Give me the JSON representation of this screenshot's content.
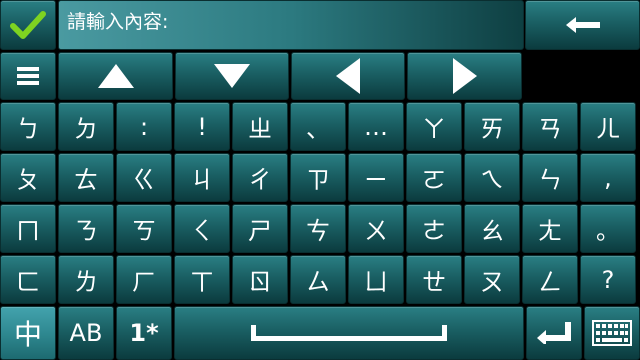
{
  "input": {
    "placeholder": "請輸入內容:"
  },
  "icons": {
    "confirm": "checkmark-icon",
    "backspace": "arrow-left-icon",
    "menu": "menu-icon",
    "up": "arrow-up-icon",
    "down": "arrow-down-icon",
    "left": "arrow-left-icon",
    "right": "arrow-right-icon",
    "space": "space-bar-icon",
    "enter": "enter-icon",
    "keyboard": "keyboard-icon"
  },
  "rows": [
    [
      "ㄅ",
      "ㄉ",
      ":",
      "!",
      "ㄓ",
      "、",
      "…",
      "ㄚ",
      "ㄞ",
      "ㄢ",
      "ㄦ"
    ],
    [
      "ㄆ",
      "ㄊ",
      "ㄍ",
      "ㄐ",
      "ㄔ",
      "ㄗ",
      "ㄧ",
      "ㄛ",
      "ㄟ",
      "ㄣ",
      ","
    ],
    [
      "ㄇ",
      "ㄋ",
      "ㄎ",
      "ㄑ",
      "ㄕ",
      "ㄘ",
      "ㄨ",
      "ㄜ",
      "ㄠ",
      "ㄤ",
      "。"
    ],
    [
      "ㄈ",
      "ㄌ",
      "ㄏ",
      "ㄒ",
      "ㄖ",
      "ㄙ",
      "ㄩ",
      "ㄝ",
      "ㄡ",
      "ㄥ",
      "?"
    ]
  ],
  "bottom": {
    "lang": "中",
    "abc": "AB",
    "num": "1*"
  },
  "colors": {
    "accent_check": "#7ed321",
    "key_top": "#2a7f84",
    "key_bottom": "#0b3b3e"
  }
}
